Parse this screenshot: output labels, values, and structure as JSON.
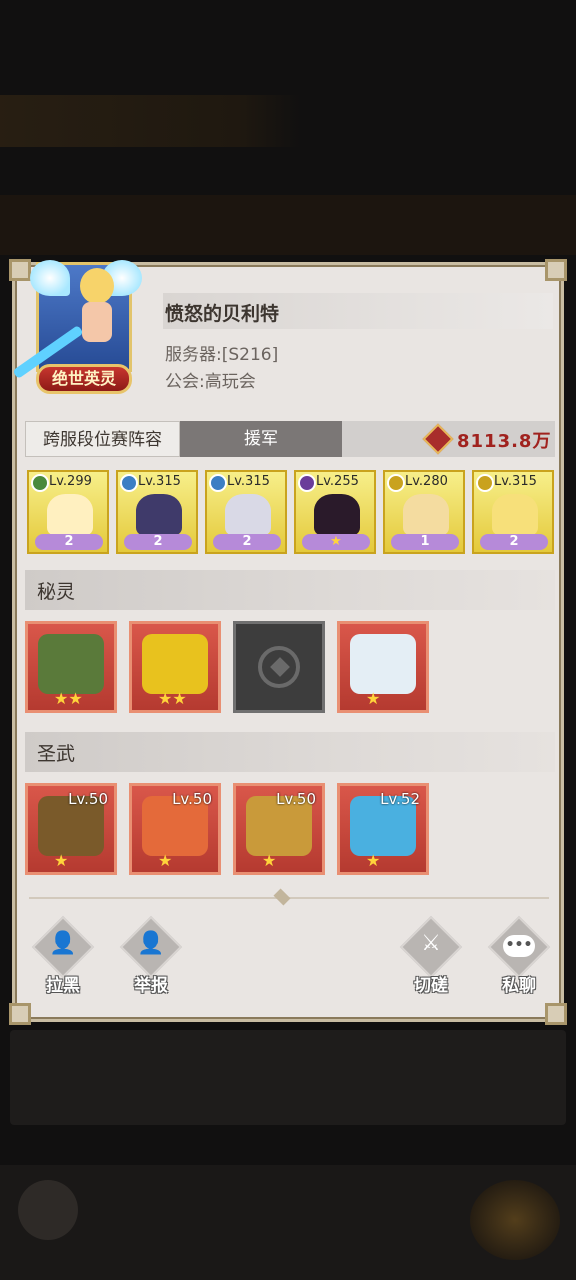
{
  "player": {
    "name": "愤怒的贝利特",
    "server": "服务器:[S216]",
    "guild": "公会:高玩会",
    "avatar_badge": "绝世英灵"
  },
  "tabs": [
    {
      "label": "跨服段位赛阵容",
      "active": true
    },
    {
      "label": "援军",
      "active": false
    }
  ],
  "power": {
    "value": "8113.8万",
    "icon": "power-crest-icon"
  },
  "heroes": [
    {
      "level": "Lv.299",
      "stars": "2",
      "element_color": "#4a8a3c",
      "art_color": "#fff0c0"
    },
    {
      "level": "Lv.315",
      "stars": "2",
      "element_color": "#3c7ec4",
      "art_color": "#3f3a6a"
    },
    {
      "level": "Lv.315",
      "stars": "2",
      "element_color": "#3c7ec4",
      "art_color": "#d9d9e6"
    },
    {
      "level": "Lv.255",
      "stars": "★",
      "element_color": "#6a3c9a",
      "art_color": "#2a1a2a"
    },
    {
      "level": "Lv.280",
      "stars": "1",
      "element_color": "#c9a21e",
      "art_color": "#f4dca0"
    },
    {
      "level": "Lv.315",
      "stars": "2",
      "element_color": "#c9a21e",
      "art_color": "#f7e07a"
    }
  ],
  "sections": {
    "spirits_title": "秘灵",
    "weapons_title": "圣武"
  },
  "spirits": [
    {
      "name": "spirit-dragon-icon",
      "stars": "★★",
      "art_color": "#5a7a3a",
      "locked": false
    },
    {
      "name": "spirit-thunderbird-icon",
      "stars": "★★",
      "art_color": "#e8c21e",
      "locked": false
    },
    {
      "name": "locked-slot-icon",
      "stars": "",
      "art_color": "#3d3d3d",
      "locked": true
    },
    {
      "name": "spirit-white-dragon-icon",
      "stars": "★",
      "art_color": "#e4eef5",
      "locked": false
    }
  ],
  "weapons": [
    {
      "name": "nature-staff-icon",
      "level": "Lv.50",
      "stars": "★",
      "art_color": "#7a5a2a"
    },
    {
      "name": "flame-sword-icon",
      "level": "Lv.50",
      "stars": "★",
      "art_color": "#e46a3a"
    },
    {
      "name": "golden-scepter-icon",
      "level": "Lv.50",
      "stars": "★",
      "art_color": "#c99a3a"
    },
    {
      "name": "frost-harp-icon",
      "level": "Lv.52",
      "stars": "★",
      "art_color": "#4ab0e0"
    }
  ],
  "actions": {
    "blacklist": "拉黑",
    "report": "举报",
    "duel": "切磋",
    "private_chat": "私聊"
  },
  "colors": {
    "accent_red": "#a0221e",
    "card_gold": "#e4c93b",
    "slot_red": "#b53a30"
  }
}
